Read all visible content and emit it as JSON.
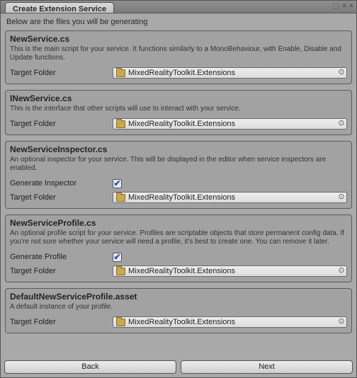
{
  "window_title": "Create Extension Service",
  "intro": "Below are the files you will be generating",
  "labels": {
    "target_folder": "Target Folder",
    "generate_inspector": "Generate Inspector",
    "generate_profile": "Generate Profile"
  },
  "sections": [
    {
      "title": "NewService.cs",
      "desc": "This is the main script for your service. It functions similarly to a MonoBehaviour, with Enable, Disable and Update functions.",
      "folder": "MixedRealityToolkit.Extensions"
    },
    {
      "title": "INewService.cs",
      "desc": "This is the interface that other scripts will use to interact with your service.",
      "folder": "MixedRealityToolkit.Extensions"
    },
    {
      "title": "NewServiceInspector.cs",
      "desc": "An optional inspector for your service. This will be displayed in the editor when service inspectors are enabled.",
      "generate": true,
      "generate_label_key": "generate_inspector",
      "folder": "MixedRealityToolkit.Extensions"
    },
    {
      "title": "NewServiceProfile.cs",
      "desc": "An optional profile script for your service. Profiles are scriptable objects that store permanent config data. If you're not sure whether your service will need a profile, it's best to create one. You can remove it later.",
      "generate": true,
      "generate_label_key": "generate_profile",
      "folder": "MixedRealityToolkit.Extensions"
    },
    {
      "title": "DefaultNewServiceProfile.asset",
      "desc": "A default instance of your profile.",
      "folder": "MixedRealityToolkit.Extensions"
    }
  ],
  "buttons": {
    "back": "Back",
    "next": "Next"
  }
}
